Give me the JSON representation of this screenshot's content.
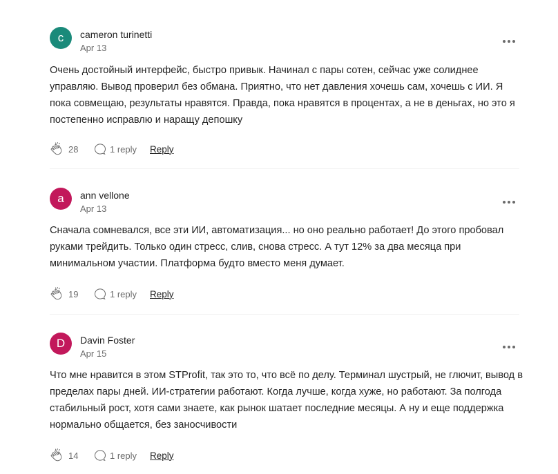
{
  "comments": [
    {
      "avatar_letter": "c",
      "avatar_color": "#1a8a7a",
      "author": "cameron turinetti",
      "date": "Apr 13",
      "text": "Очень достойный интерфейс, быстро привык. Начинал с пары сотен, сейчас уже солиднее управляю. Вывод проверил без обмана. Приятно, что нет давления хочешь сам, хочешь с ИИ. Я пока совмещаю, результаты нравятся. Правда, пока нравятся в процентах, а не в деньгах, но это я постепенно исправлю и наращу депошку",
      "claps": "28",
      "replies": "1 reply",
      "reply_label": "Reply"
    },
    {
      "avatar_letter": "a",
      "avatar_color": "#c2185b",
      "author": "ann vellone",
      "date": "Apr 13",
      "text": "Сначала сомневался, все эти ИИ, автоматизация... но оно реально работает! До этого пробовал руками трейдить. Только один стресс, слив, снова стресс. А тут 12% за два месяца при минимальном участии. Платформа будто вместо меня думает.",
      "claps": "19",
      "replies": "1 reply",
      "reply_label": "Reply"
    },
    {
      "avatar_letter": "D",
      "avatar_color": "#c2185b",
      "author": "Davin Foster",
      "date": "Apr 15",
      "text": "Что мне нравится в этом STProfit, так это то, что всё по делу. Терминал шустрый, не глючит, вывод в пределах пары дней. ИИ-стратегии работают. Когда лучше, когда хуже, но работают. За полгода стабильный рост, хотя сами знаете, как рынок шатает последние месяцы. А ну и еще поддержка нормально общается, без заносчивости",
      "claps": "14",
      "replies": "1 reply",
      "reply_label": "Reply"
    }
  ]
}
